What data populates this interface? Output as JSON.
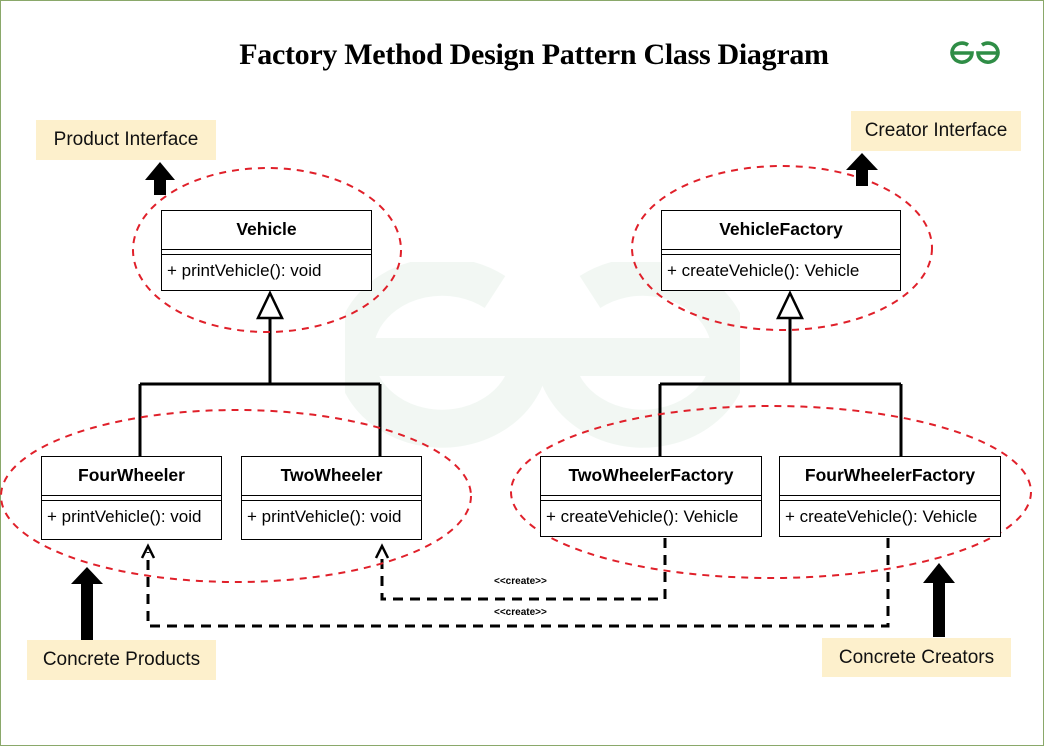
{
  "title": "Factory Method Design Pattern Class Diagram",
  "logo": {
    "icon": "gfg-logo-icon",
    "color": "#2f8d46"
  },
  "watermark": {
    "icon": "gfg-watermark-icon"
  },
  "colors": {
    "group_outline": "#e0202a",
    "note_background": "#fdf0cc",
    "frame_border": "#8aa86a"
  },
  "notes": {
    "product_interface": "Product Interface",
    "creator_interface": "Creator Interface",
    "concrete_products": "Concrete Products",
    "concrete_creators": "Concrete Creators"
  },
  "classes": {
    "vehicle": {
      "name": "Vehicle",
      "operation": "+ printVehicle(): void"
    },
    "vehicle_factory": {
      "name": "VehicleFactory",
      "operation": "+ createVehicle(): Vehicle"
    },
    "four_wheeler": {
      "name": "FourWheeler",
      "operation": "+ printVehicle(): void"
    },
    "two_wheeler": {
      "name": "TwoWheeler",
      "operation": "+ printVehicle(): void"
    },
    "two_wheeler_factory": {
      "name": "TwoWheelerFactory",
      "operation": "+ createVehicle(): Vehicle"
    },
    "four_wheeler_factory": {
      "name": "FourWheelerFactory",
      "operation": "+ createVehicle(): Vehicle"
    }
  },
  "relations": {
    "create_upper": "<<create>>",
    "create_lower": "<<create>>"
  }
}
